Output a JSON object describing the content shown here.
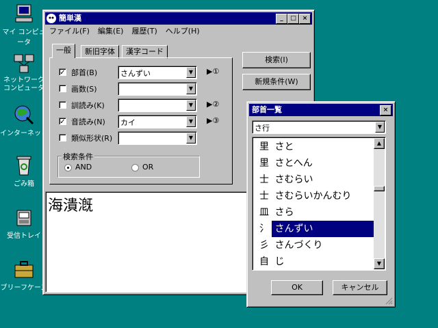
{
  "desktop": {
    "icons": [
      {
        "label": "マイ コンピュータ"
      },
      {
        "label": "ネットワーク コンピュータ"
      },
      {
        "label": "インターネット"
      },
      {
        "label": "ごみ箱"
      },
      {
        "label": "受信トレイ"
      },
      {
        "label": "ブリーフケース"
      }
    ]
  },
  "main_window": {
    "title": "簡単漢",
    "menu": [
      "ファイル(F)",
      "編集(E)",
      "履歴(T)",
      "ヘルプ(H)"
    ],
    "tabs": [
      "一般",
      "新旧字体",
      "漢字コード"
    ],
    "fields": [
      {
        "label": "部首(B)",
        "checked": true,
        "value": "さんずい",
        "ref": "▶①"
      },
      {
        "label": "画数(S)",
        "checked": false,
        "value": "",
        "ref": ""
      },
      {
        "label": "訓読み(K)",
        "checked": false,
        "value": "",
        "ref": "▶②"
      },
      {
        "label": "音読み(N)",
        "checked": true,
        "value": "カイ",
        "ref": "▶③"
      },
      {
        "label": "類似形状(R)",
        "checked": false,
        "value": "",
        "ref": ""
      }
    ],
    "search_condition": {
      "title": "検索条件",
      "and_label": "AND",
      "or_label": "OR",
      "selected": "AND"
    },
    "search_button": "検索(I)",
    "new_condition_button": "新規条件(W)",
    "result_text": "海潰漑",
    "check_mark": "✓"
  },
  "radical_dialog": {
    "title": "部首一覧",
    "group": "さ行",
    "items": [
      {
        "kanji": "里",
        "reading": "さと"
      },
      {
        "kanji": "里",
        "reading": "さとへん"
      },
      {
        "kanji": "士",
        "reading": "さむらい"
      },
      {
        "kanji": "士",
        "reading": "さむらいかんむり"
      },
      {
        "kanji": "皿",
        "reading": "さら"
      },
      {
        "kanji": "氵",
        "reading": "さんずい"
      },
      {
        "kanji": "彡",
        "reading": "さんづくり"
      },
      {
        "kanji": "自",
        "reading": "じ"
      }
    ],
    "selected_index": 5,
    "ok_button": "OK",
    "cancel_button": "キャンセル"
  },
  "colors": {
    "desktop": "#008080",
    "titlebar": "#000080",
    "face": "#c0c0c0"
  }
}
